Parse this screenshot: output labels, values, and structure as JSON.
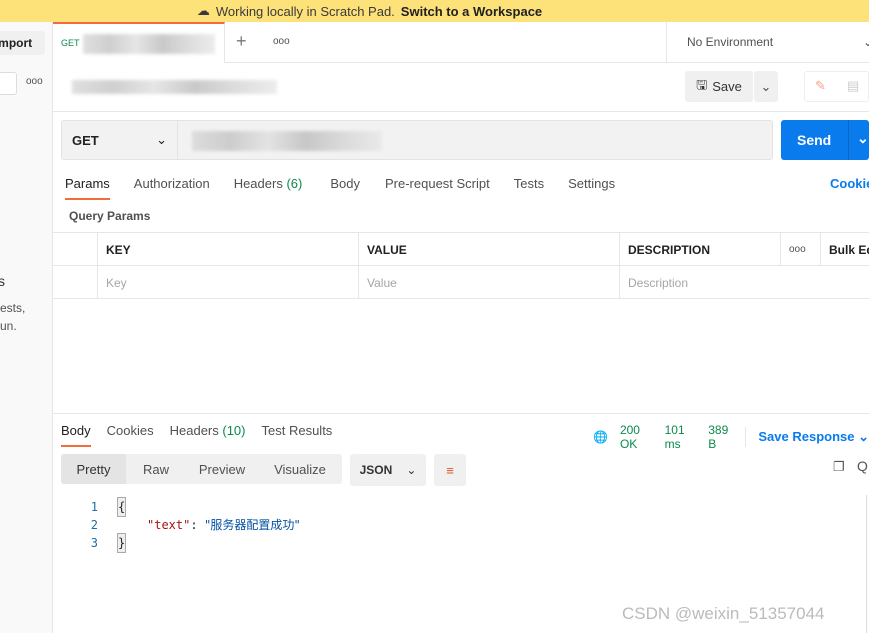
{
  "banner": {
    "text": "Working locally in Scratch Pad.",
    "link": "Switch to a Workspace"
  },
  "sidebar": {
    "import_label": "Import",
    "more": "ooo",
    "text1": "s",
    "text2": "ests,",
    "text3": "un."
  },
  "tab": {
    "method": "GET",
    "new": "+",
    "more": "ooo"
  },
  "environment": {
    "label": "No Environment"
  },
  "toolbar": {
    "save_label": "Save"
  },
  "request": {
    "method": "GET",
    "send_label": "Send"
  },
  "req_tabs": [
    "Params",
    "Authorization",
    "Headers",
    "Body",
    "Pre-request Script",
    "Tests",
    "Settings"
  ],
  "headers_count": "(6)",
  "cookies_link": "Cookies",
  "query_params": {
    "title": "Query Params",
    "columns": [
      "KEY",
      "VALUE",
      "DESCRIPTION"
    ],
    "more": "ooo",
    "bulk_edit": "Bulk Edit",
    "placeholders": [
      "Key",
      "Value",
      "Description"
    ]
  },
  "response": {
    "tabs": [
      "Body",
      "Cookies",
      "Headers",
      "Test Results"
    ],
    "headers_count": "(10)",
    "status": "200 OK",
    "time": "101 ms",
    "size": "389 B",
    "save_response": "Save Response",
    "views": [
      "Pretty",
      "Raw",
      "Preview",
      "Visualize"
    ],
    "format": "JSON",
    "lines": [
      {
        "n": "1",
        "text": "{"
      },
      {
        "n": "2",
        "key": "\"text\"",
        "value": "\"服务器配置成功\""
      },
      {
        "n": "3",
        "text": "}"
      }
    ]
  },
  "watermark": "CSDN @weixin_51357044",
  "colors": {
    "accent": "#f26b3a",
    "send": "#097bed",
    "banner": "#fde27a",
    "status": "#0b8a4a"
  }
}
